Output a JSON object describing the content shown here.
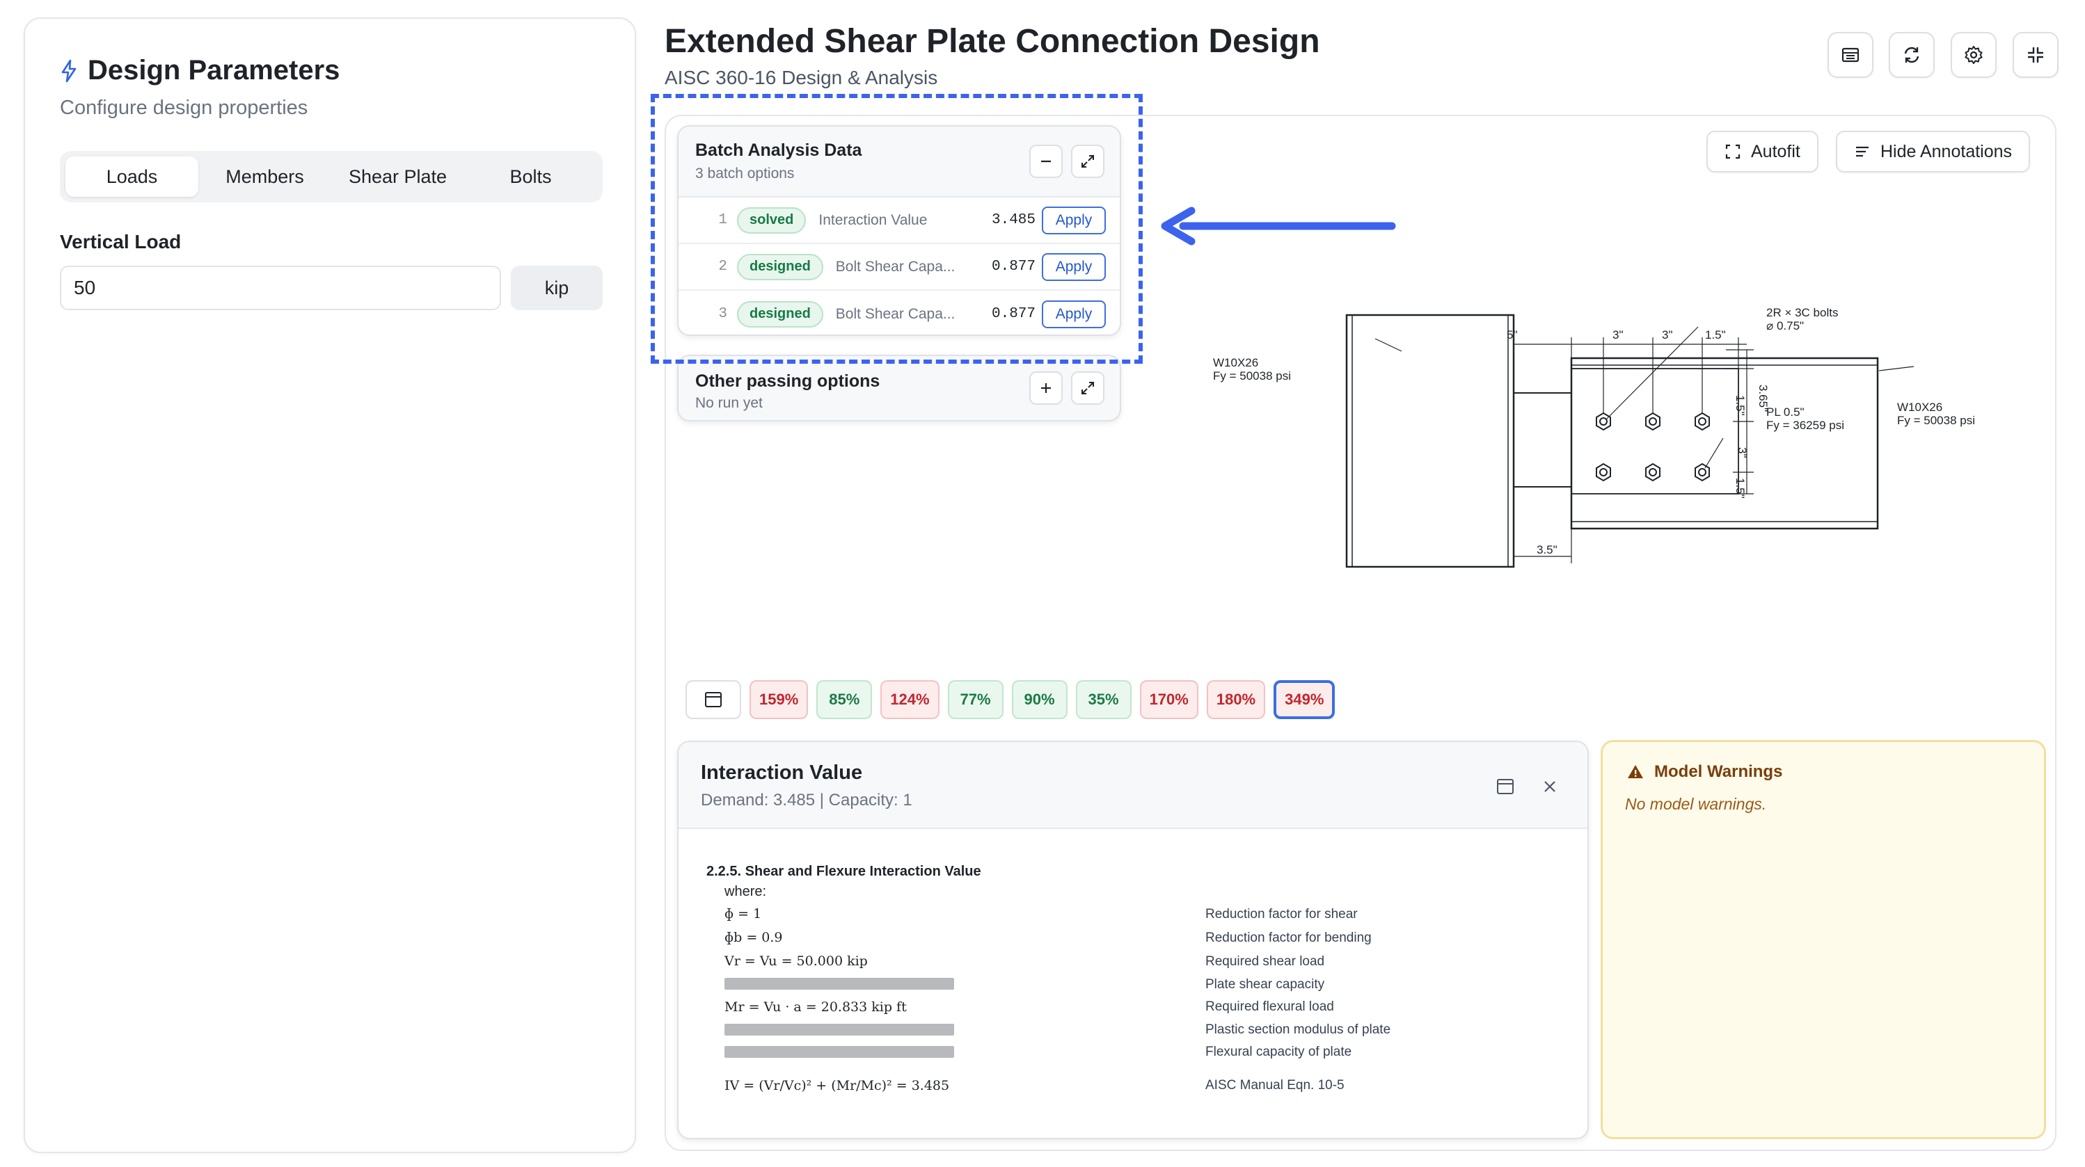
{
  "left_panel": {
    "title": "Design Parameters",
    "subtitle": "Configure design properties",
    "tabs": [
      "Loads",
      "Members",
      "Shear Plate",
      "Bolts"
    ],
    "active_tab": "Loads",
    "field_label": "Vertical Load",
    "field_value": "50",
    "field_unit": "kip"
  },
  "header": {
    "title": "Extended Shear Plate Connection Design",
    "subtitle": "AISC 360-16 Design & Analysis",
    "buttons": [
      "table-icon",
      "refresh-icon",
      "settings-icon",
      "collapse-icon"
    ]
  },
  "toolbar": {
    "autofit_label": "Autofit",
    "annotations_label": "Hide Annotations"
  },
  "batch_card": {
    "title": "Batch Analysis Data",
    "subtitle": "3 batch options",
    "rows": [
      {
        "num": "1",
        "status": "solved",
        "name": "Interaction Value",
        "value": "3.485",
        "action": "Apply"
      },
      {
        "num": "2",
        "status": "designed",
        "name": "Bolt Shear Capa...",
        "value": "0.877",
        "action": "Apply"
      },
      {
        "num": "3",
        "status": "designed",
        "name": "Bolt Shear Capa...",
        "value": "0.877",
        "action": "Apply"
      }
    ]
  },
  "other_card": {
    "title": "Other passing options",
    "subtitle": "No run yet"
  },
  "drawing": {
    "left_member": "W10X26",
    "left_fy": "Fy = 50038 psi",
    "right_member": "W10X26",
    "right_fy": "Fy = 50038 psi",
    "bolts": "2R × 3C bolts",
    "bolt_dia": "⌀ 0.75\"",
    "plate": "PL 0.5\"",
    "plate_fy": "Fy = 36259 psi",
    "dims": {
      "d1": "5\"",
      "d2": "3\"",
      "d3": "3\"",
      "d4": "1.5\"",
      "v1": "3.65\"",
      "v2": "1.5\"",
      "v3": "3\"",
      "v4": "1.5\"",
      "gap": "3.5\""
    }
  },
  "chips": [
    {
      "label": "159%",
      "status": "fail"
    },
    {
      "label": "85%",
      "status": "pass"
    },
    {
      "label": "124%",
      "status": "fail"
    },
    {
      "label": "77%",
      "status": "pass"
    },
    {
      "label": "90%",
      "status": "pass"
    },
    {
      "label": "35%",
      "status": "pass"
    },
    {
      "label": "170%",
      "status": "fail"
    },
    {
      "label": "180%",
      "status": "fail"
    },
    {
      "label": "349%",
      "status": "fail",
      "selected": true
    }
  ],
  "calc": {
    "title": "Interaction Value",
    "subtitle": "Demand: 3.485 | Capacity: 1",
    "section": "2.2.5. Shear and Flexure Interaction Value",
    "where": "where:",
    "lines": [
      {
        "eq": "ɸ = 1",
        "desc": "Reduction factor for shear"
      },
      {
        "eq": "ɸb = 0.9",
        "desc": "Reduction factor for bending"
      },
      {
        "eq": "Vr = Vu = 50.000 kip",
        "desc": "Required shear load"
      },
      {
        "eq": "",
        "desc": "Plate shear capacity"
      },
      {
        "eq": "Mr = Vu · a = 20.833 kip ft",
        "desc": "Required flexural load"
      },
      {
        "eq": "",
        "desc": "Plastic section modulus of plate"
      },
      {
        "eq": "",
        "desc": "Flexural capacity of plate"
      },
      {
        "eq": "IV = (Vr/Vc)² + (Mr/Mc)² = 3.485",
        "desc": "AISC Manual Eqn. 10-5"
      }
    ]
  },
  "warnings": {
    "title": "Model Warnings",
    "message": "No model warnings."
  },
  "colors": {
    "accent": "#3b63ee",
    "pass": "#1c7a45",
    "fail": "#c0262d",
    "warning_bg": "#fefbea"
  }
}
